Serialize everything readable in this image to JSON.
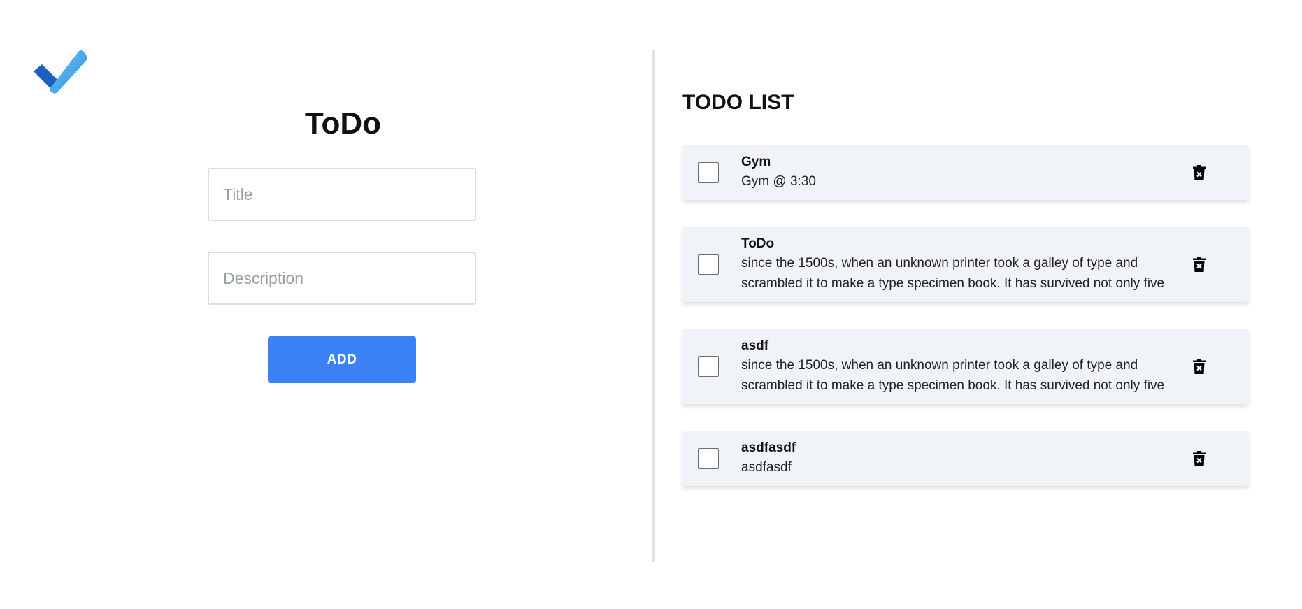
{
  "app": {
    "logo_icon": "checkmark-logo-icon",
    "title": "ToDo"
  },
  "form": {
    "title_placeholder": "Title",
    "title_value": "",
    "description_placeholder": "Description",
    "description_value": "",
    "add_label": "ADD",
    "accent_color": "#3b82f6"
  },
  "list": {
    "heading": "TODO LIST",
    "items": [
      {
        "title": "Gym",
        "description": "Gym @ 3:30",
        "checked": false,
        "delete_icon": "trash-icon"
      },
      {
        "title": "ToDo",
        "description": "since the 1500s, when an unknown printer took a galley of type and scrambled it to make a type specimen book. It has survived not only five",
        "checked": false,
        "delete_icon": "trash-icon"
      },
      {
        "title": "asdf",
        "description": "since the 1500s, when an unknown printer took a galley of type and scrambled it to make a type specimen book. It has survived not only five",
        "checked": false,
        "delete_icon": "trash-icon"
      },
      {
        "title": "asdfasdf",
        "description": "asdfasdf",
        "checked": false,
        "delete_icon": "trash-icon"
      }
    ]
  }
}
